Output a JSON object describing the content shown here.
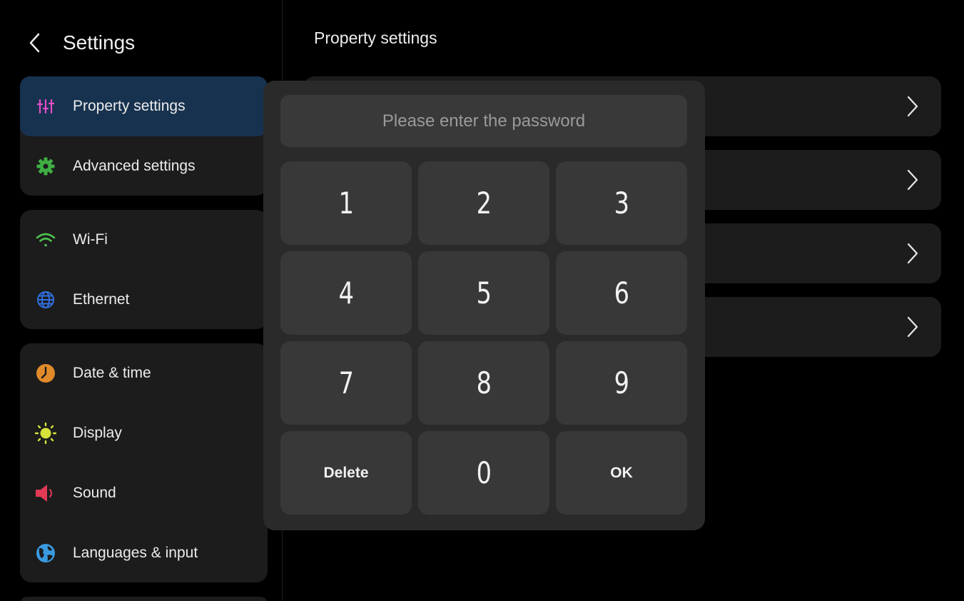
{
  "sidebar": {
    "title": "Settings",
    "groups": [
      {
        "items": [
          {
            "label": "Property settings",
            "icon": "sliders-icon",
            "color": "#e24ec8",
            "active": true
          },
          {
            "label": "Advanced settings",
            "icon": "gear-icon",
            "color": "#3fae43"
          }
        ]
      },
      {
        "items": [
          {
            "label": "Wi-Fi",
            "icon": "wifi-icon",
            "color": "#4ec24e"
          },
          {
            "label": "Ethernet",
            "icon": "globe-icon",
            "color": "#2f6fe0"
          }
        ]
      },
      {
        "items": [
          {
            "label": "Date & time",
            "icon": "clock-icon",
            "color": "#e08a2a"
          },
          {
            "label": "Display",
            "icon": "sun-icon",
            "color": "#d6e23a"
          },
          {
            "label": "Sound",
            "icon": "speaker-icon",
            "color": "#e03a55"
          },
          {
            "label": "Languages & input",
            "icon": "earth-icon",
            "color": "#3a9ae0"
          }
        ]
      }
    ]
  },
  "main": {
    "title": "Property settings",
    "rows": 4
  },
  "dialog": {
    "placeholder": "Please enter the password",
    "keys": [
      "1",
      "2",
      "3",
      "4",
      "5",
      "6",
      "7",
      "8",
      "9",
      "Delete",
      "0",
      "OK"
    ]
  },
  "colors": {
    "background": "#000000",
    "panel": "#1c1c1c",
    "active": "#17324f",
    "dialog": "#2a2a2a",
    "key": "#383838"
  }
}
